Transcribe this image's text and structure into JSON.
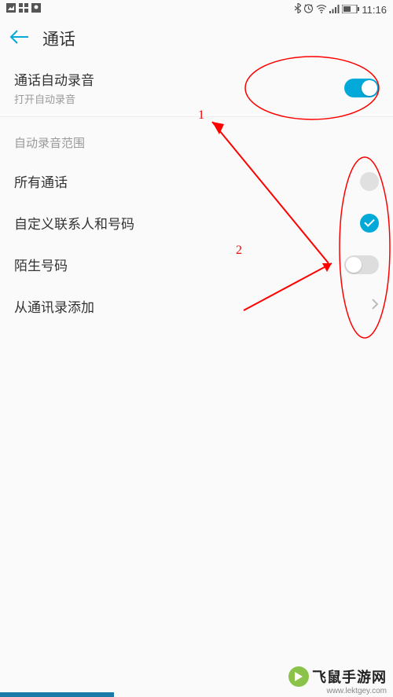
{
  "status": {
    "time": "11:16"
  },
  "header": {
    "title": "通话"
  },
  "auto_record": {
    "title": "通话自动录音",
    "subtitle": "打开自动录音"
  },
  "section": {
    "label": "自动录音范围"
  },
  "options": {
    "all_calls": "所有通话",
    "custom_contacts": "自定义联系人和号码",
    "unknown_numbers": "陌生号码",
    "add_from_contacts": "从通讯录添加"
  },
  "annotations": {
    "label1": "1",
    "label2": "2"
  },
  "watermark": {
    "brand": "飞鼠手游网",
    "url": "www.lektgey.com"
  }
}
